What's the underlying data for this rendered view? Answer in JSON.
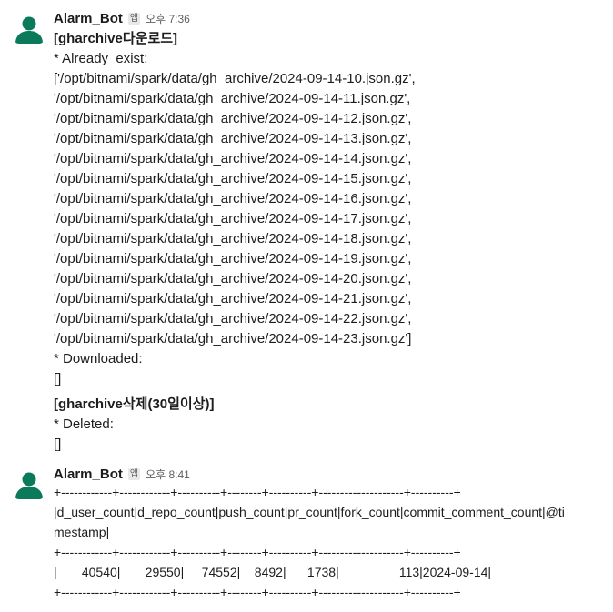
{
  "messages": [
    {
      "sender": "Alarm_Bot",
      "badge": "앱",
      "time": "오후 7:36",
      "lines": [
        {
          "text": "[gharchive다운로드]",
          "bold": true
        },
        {
          "text": "* Already_exist:",
          "bold": false
        },
        {
          "text": "['/opt/bitnami/spark/data/gh_archive/2024-09-14-10.json.gz',",
          "bold": false
        },
        {
          "text": "'/opt/bitnami/spark/data/gh_archive/2024-09-14-11.json.gz',",
          "bold": false
        },
        {
          "text": "'/opt/bitnami/spark/data/gh_archive/2024-09-14-12.json.gz',",
          "bold": false
        },
        {
          "text": "'/opt/bitnami/spark/data/gh_archive/2024-09-14-13.json.gz',",
          "bold": false
        },
        {
          "text": "'/opt/bitnami/spark/data/gh_archive/2024-09-14-14.json.gz',",
          "bold": false
        },
        {
          "text": "'/opt/bitnami/spark/data/gh_archive/2024-09-14-15.json.gz',",
          "bold": false
        },
        {
          "text": "'/opt/bitnami/spark/data/gh_archive/2024-09-14-16.json.gz',",
          "bold": false
        },
        {
          "text": "'/opt/bitnami/spark/data/gh_archive/2024-09-14-17.json.gz',",
          "bold": false
        },
        {
          "text": "'/opt/bitnami/spark/data/gh_archive/2024-09-14-18.json.gz',",
          "bold": false
        },
        {
          "text": "'/opt/bitnami/spark/data/gh_archive/2024-09-14-19.json.gz',",
          "bold": false
        },
        {
          "text": "'/opt/bitnami/spark/data/gh_archive/2024-09-14-20.json.gz',",
          "bold": false
        },
        {
          "text": "'/opt/bitnami/spark/data/gh_archive/2024-09-14-21.json.gz',",
          "bold": false
        },
        {
          "text": "'/opt/bitnami/spark/data/gh_archive/2024-09-14-22.json.gz',",
          "bold": false
        },
        {
          "text": "'/opt/bitnami/spark/data/gh_archive/2024-09-14-23.json.gz']",
          "bold": false
        },
        {
          "text": "* Downloaded:",
          "bold": false
        },
        {
          "text": "[]",
          "bold": false
        },
        {
          "text": "",
          "bold": false,
          "gap": true
        },
        {
          "text": "[gharchive삭제(30일이상)]",
          "bold": true
        },
        {
          "text": "* Deleted:",
          "bold": false
        },
        {
          "text": "[]",
          "bold": false
        }
      ]
    },
    {
      "sender": "Alarm_Bot",
      "badge": "앱",
      "time": "오후 8:41",
      "lines": [
        {
          "text": "+------------+------------+----------+--------+----------+--------------------+----------+"
        },
        {
          "text": "|d_user_count|d_repo_count|push_count|pr_count|fork_count|commit_comment_count|@ti"
        },
        {
          "text": "mestamp|"
        },
        {
          "text": "+------------+------------+----------+--------+----------+--------------------+----------+"
        },
        {
          "text": "|       40540|       29550|     74552|    8492|      1738|                 113|2024-09-14|"
        },
        {
          "text": "+------------+------------+----------+--------+----------+--------------------+----------+"
        }
      ]
    }
  ],
  "colors": {
    "avatar_bg": "#ffffff",
    "avatar_fg": "#0b7a5b",
    "text": "#1d1c1d",
    "muted": "#616061"
  },
  "icons": {
    "avatar": "user-silhouette-icon"
  }
}
